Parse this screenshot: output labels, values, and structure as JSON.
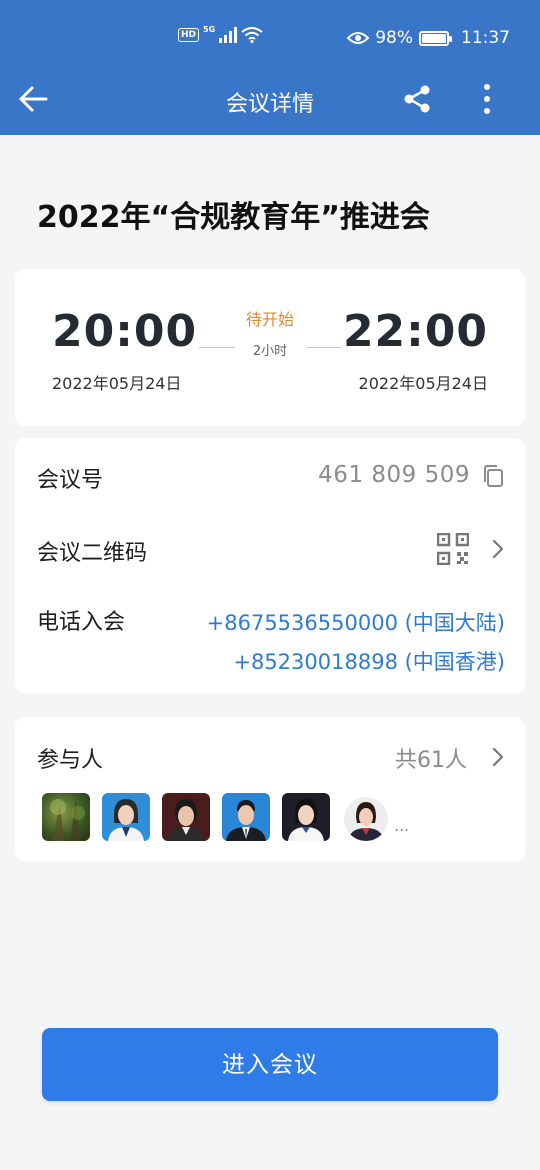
{
  "status_bar": {
    "network_hd": "HD",
    "network_5g": "5G",
    "battery": "98%",
    "battery_level": 0.98,
    "time": "11:37",
    "icons": [
      "signal-icon",
      "wifi-icon",
      "eye-icon",
      "battery-icon"
    ]
  },
  "header": {
    "title": "会议详情",
    "back_icon": "arrow-left-icon",
    "share_icon": "share-icon",
    "more_icon": "more-vertical-icon"
  },
  "meeting": {
    "title": "2022年“合规教育年”推进会",
    "start_time": "20:00",
    "start_date": "2022年05月24日",
    "status": "待开始",
    "duration": "2小时",
    "end_time": "22:00",
    "end_date": "2022年05月24日"
  },
  "info": {
    "id_label": "会议号",
    "id_value": "461 809 509",
    "qr_label": "会议二维码",
    "phone_label": "电话入会",
    "phones": [
      "+8675536550000 (中国大陆)",
      "+85230018898 (中国香港)"
    ]
  },
  "participants": {
    "label": "参与人",
    "count": "共61人",
    "more": "...",
    "avatars": [
      "avatar-1",
      "avatar-2",
      "avatar-3",
      "avatar-4",
      "avatar-5",
      "avatar-6"
    ]
  },
  "actions": {
    "join_label": "进入会议"
  },
  "colors": {
    "header_bg": "#3a76c8",
    "status_orange": "#e38a2a",
    "link_blue": "#2f7bd4",
    "button_blue": "#2f7be8",
    "page_bg": "#f4f5f7"
  }
}
